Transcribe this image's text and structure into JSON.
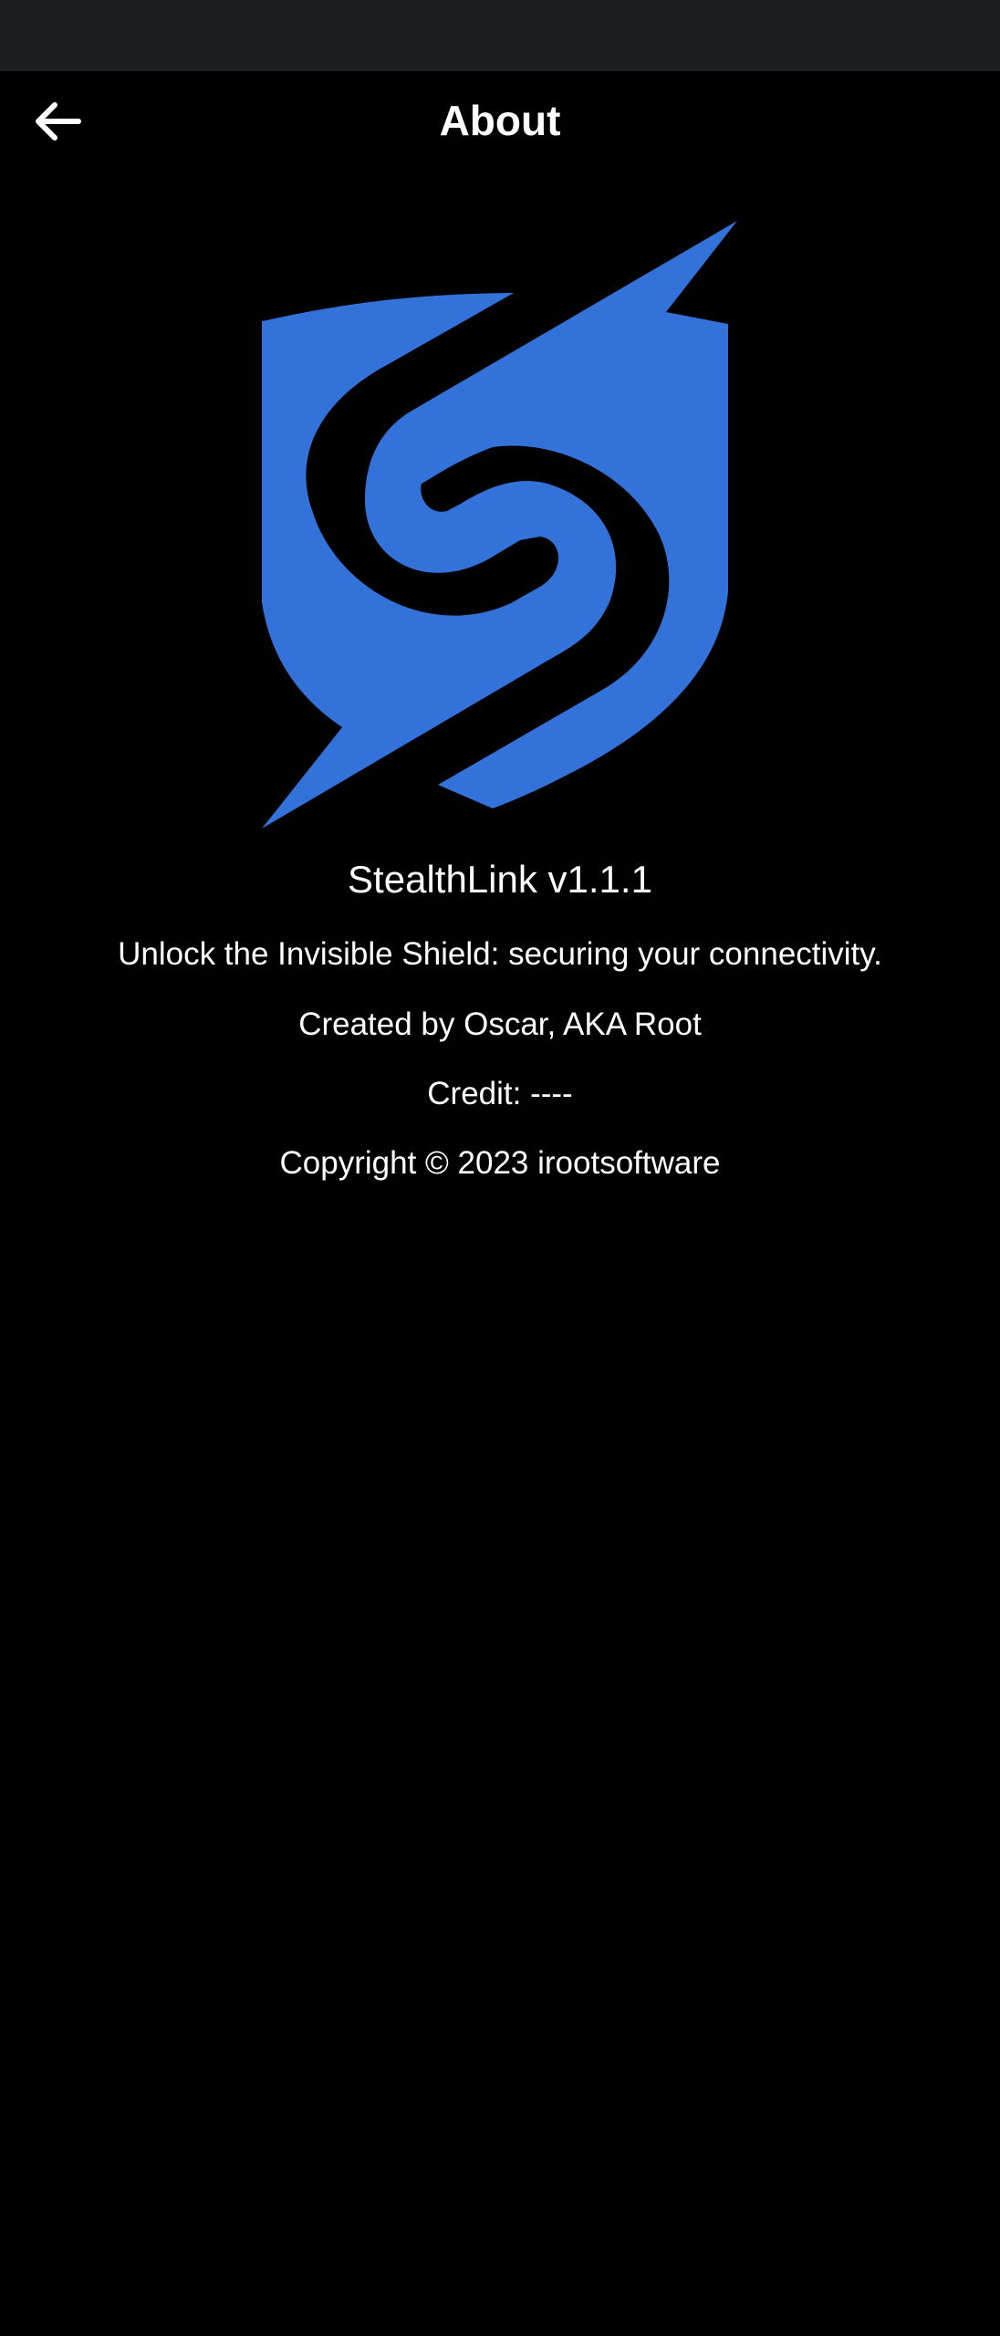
{
  "app_bar": {
    "title": "About",
    "back_icon": "arrow-left-icon"
  },
  "logo": {
    "icon": "shield-s-logo-icon",
    "color": "#3372d9"
  },
  "about": {
    "version": "StealthLink v1.1.1",
    "tagline": "Unlock the Invisible Shield: securing your connectivity.",
    "creator": "Created by Oscar, AKA Root",
    "credit": "Credit: ----",
    "copyright": "Copyright © 2023 irootsoftware"
  },
  "colors": {
    "background": "#000000",
    "status_bar": "#1c1d1f",
    "text": "#ffffff",
    "accent": "#3372d9"
  }
}
